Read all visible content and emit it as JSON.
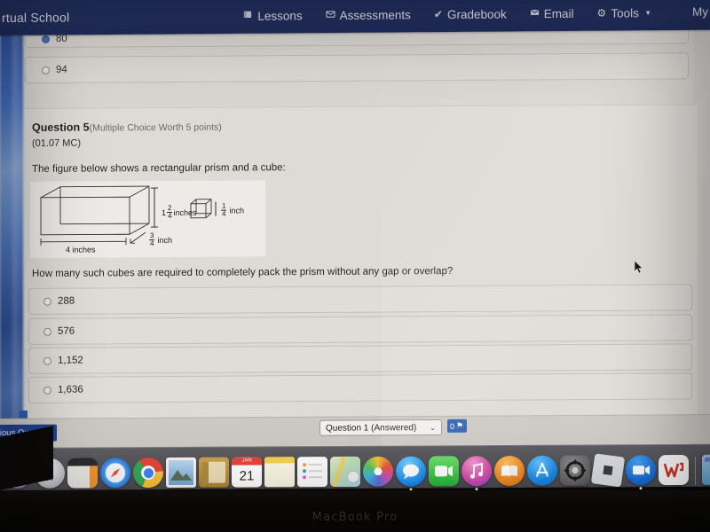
{
  "navbar": {
    "brand": "rtual School",
    "right_cut": "My",
    "items": [
      {
        "label": "Lessons",
        "icon": "book-icon",
        "glyph": "▤"
      },
      {
        "label": "Assessments",
        "icon": "folder-icon",
        "glyph": "✉"
      },
      {
        "label": "Gradebook",
        "icon": "check-icon",
        "glyph": "✔"
      },
      {
        "label": "Email",
        "icon": "envelope-icon",
        "glyph": "✉"
      },
      {
        "label": "Tools",
        "icon": "gear-icon",
        "glyph": "⚙",
        "caret": "▾"
      }
    ]
  },
  "previous_question": {
    "options": [
      {
        "label": "80",
        "selected": true
      },
      {
        "label": "94",
        "selected": false
      }
    ]
  },
  "question": {
    "number_label": "Question 5",
    "meta": "(Multiple Choice Worth 5 points)",
    "code": "(01.07 MC)",
    "stem": "The figure below shows a rectangular prism and a cube:",
    "ask": "How many such cubes are required to completely pack the prism without any gap or overlap?",
    "figure": {
      "prism_length_label": "4 inches",
      "prism_height_whole": "1",
      "prism_height_num": "2",
      "prism_height_den": "4",
      "prism_height_unit": "inches",
      "prism_depth_num": "3",
      "prism_depth_den": "4",
      "prism_depth_unit": "inch",
      "cube_num": "1",
      "cube_den": "4",
      "cube_unit": "inch"
    },
    "options": [
      {
        "label": "288",
        "selected": false
      },
      {
        "label": "576",
        "selected": false
      },
      {
        "label": "1,152",
        "selected": false
      },
      {
        "label": "1,636",
        "selected": false
      }
    ]
  },
  "toolbar": {
    "prev_button": "vious Question",
    "question_select_value": "Question 1 (Answered)",
    "chevron": "⌄",
    "flag_count": "0",
    "flag_glyph": "⚑"
  },
  "dock": {
    "items": [
      {
        "name": "siri-icon",
        "running": false
      },
      {
        "name": "launchpad-icon",
        "running": false
      },
      {
        "name": "calculator-icon",
        "running": false
      },
      {
        "name": "safari-icon",
        "running": false
      },
      {
        "name": "chrome-icon",
        "running": false
      },
      {
        "name": "preview-icon",
        "running": false
      },
      {
        "name": "contacts-icon",
        "running": false
      },
      {
        "name": "calendar-icon",
        "running": false,
        "badge": "21",
        "badge_top": "JAN"
      },
      {
        "name": "notes-icon",
        "running": false
      },
      {
        "name": "reminders-icon",
        "running": false
      },
      {
        "name": "maps-icon",
        "running": false
      },
      {
        "name": "photos-icon",
        "running": false
      },
      {
        "name": "messages-icon",
        "running": true
      },
      {
        "name": "facetime-icon",
        "running": false
      },
      {
        "name": "itunes-icon",
        "running": true
      },
      {
        "name": "books-icon",
        "running": false
      },
      {
        "name": "app-store-icon",
        "running": false
      },
      {
        "name": "system-preferences-icon",
        "running": false
      },
      {
        "name": "roblox-icon",
        "running": true
      },
      {
        "name": "zoom-icon",
        "running": true
      },
      {
        "name": "wps-office-icon",
        "running": false
      },
      {
        "name": "applications-folder-icon",
        "running": false
      },
      {
        "name": "downloads-stack-icon",
        "running": false
      }
    ]
  },
  "bezel": {
    "model_text": "MacBook Pro"
  },
  "colors": {
    "nav_navy": "#1d2f63",
    "accent_blue": "#1d3f93",
    "page_bg": "#ddd9d4"
  }
}
